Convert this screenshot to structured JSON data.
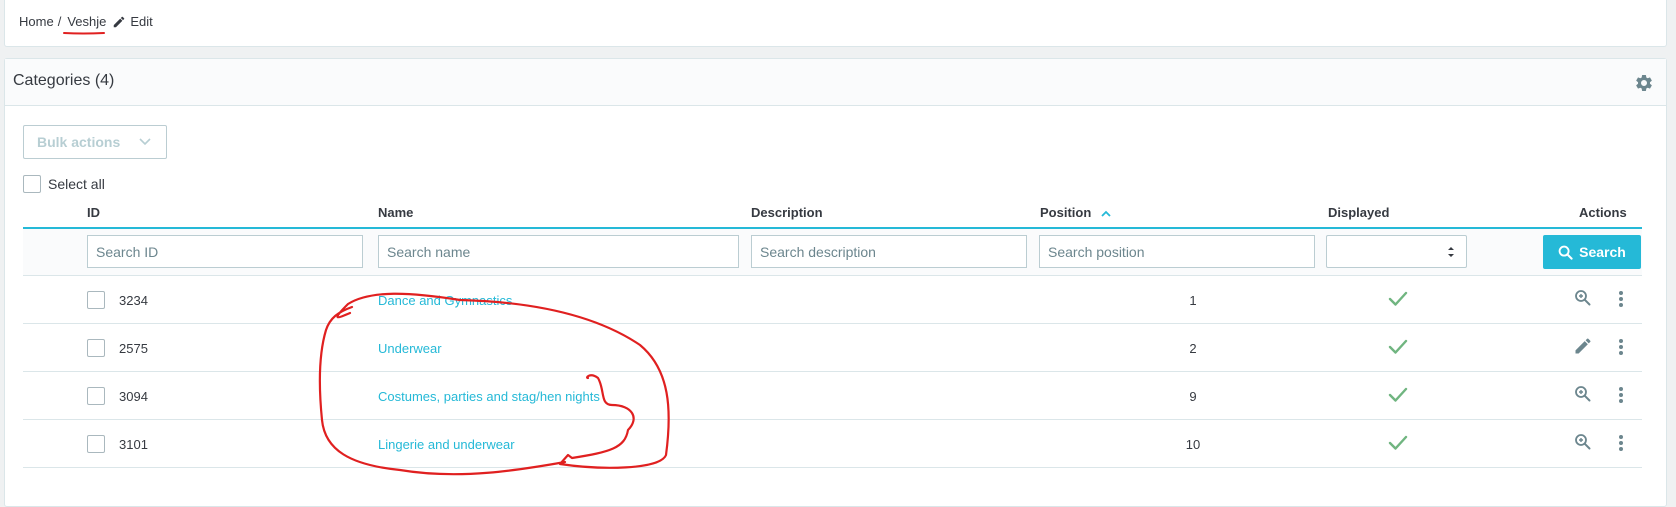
{
  "breadcrumb": {
    "home": "Home",
    "separator": "/",
    "current": "Veshje",
    "edit": "Edit"
  },
  "panel": {
    "title": "Categories (4)"
  },
  "bulk_actions": {
    "label": "Bulk actions"
  },
  "select_all": {
    "label": "Select all"
  },
  "table": {
    "columns": {
      "id": "ID",
      "name": "Name",
      "description": "Description",
      "position": "Position",
      "displayed": "Displayed",
      "actions": "Actions"
    },
    "filters": {
      "id_placeholder": "Search ID",
      "name_placeholder": "Search name",
      "description_placeholder": "Search description",
      "position_placeholder": "Search position",
      "search_button": "Search"
    },
    "rows": [
      {
        "id": "3234",
        "name": "Dance and Gymnastics",
        "position": "1",
        "displayed": true,
        "action_icon": "zoom-icon"
      },
      {
        "id": "2575",
        "name": "Underwear",
        "position": "2",
        "displayed": true,
        "action_icon": "pencil-icon"
      },
      {
        "id": "3094",
        "name": "Costumes, parties and stag/hen nights",
        "position": "9",
        "displayed": true,
        "action_icon": "zoom-icon"
      },
      {
        "id": "3101",
        "name": "Lingerie and underwear",
        "position": "10",
        "displayed": true,
        "action_icon": "zoom-icon"
      }
    ]
  },
  "colors": {
    "accent": "#25b9d7",
    "success": "#70b580",
    "annotation": "#e02020"
  }
}
